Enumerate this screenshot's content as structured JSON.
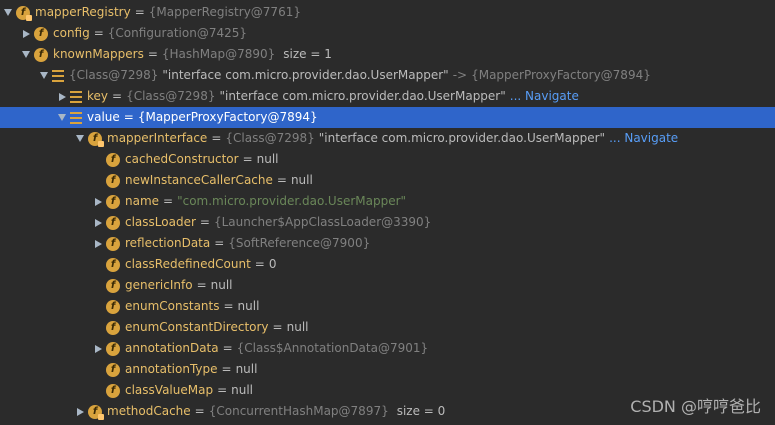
{
  "rows": [
    {
      "indent": 0,
      "arrow": "down",
      "icon": "field-static",
      "name": "mapperRegistry",
      "eq": "=",
      "ref": "{MapperRegistry@7761}"
    },
    {
      "indent": 1,
      "arrow": "right",
      "icon": "field",
      "name": "config",
      "eq": "=",
      "ref": "{Configuration@7425}"
    },
    {
      "indent": 1,
      "arrow": "down",
      "icon": "field",
      "name": "knownMappers",
      "eq": "=",
      "ref": "{HashMap@7890}",
      "extra": "size = 1"
    },
    {
      "indent": 2,
      "arrow": "down",
      "icon": "list",
      "ref": "{Class@7298}",
      "str": "\"interface com.micro.provider.dao.UserMapper\"",
      "arrowText": "->",
      "ref2": "{MapperProxyFactory@7894}"
    },
    {
      "indent": 3,
      "arrow": "right",
      "icon": "list",
      "name": "key",
      "eq": "=",
      "ref": "{Class@7298}",
      "str": "\"interface com.micro.provider.dao.UserMapper\"",
      "nav": "... Navigate"
    },
    {
      "indent": 3,
      "arrow": "down",
      "icon": "list",
      "name": "value",
      "eq": "=",
      "ref": "{MapperProxyFactory@7894}",
      "selected": true
    },
    {
      "indent": 4,
      "arrow": "down",
      "icon": "field-static",
      "name": "mapperInterface",
      "eq": "=",
      "ref": "{Class@7298}",
      "str": "\"interface com.micro.provider.dao.UserMapper\"",
      "nav": "... Navigate"
    },
    {
      "indent": 5,
      "arrow": "none",
      "icon": "field",
      "name": "cachedConstructor",
      "eq": "=",
      "val": "null"
    },
    {
      "indent": 5,
      "arrow": "none",
      "icon": "field",
      "name": "newInstanceCallerCache",
      "eq": "=",
      "val": "null"
    },
    {
      "indent": 5,
      "arrow": "right",
      "icon": "field",
      "name": "name",
      "eq": "=",
      "strg": "\"com.micro.provider.dao.UserMapper\""
    },
    {
      "indent": 5,
      "arrow": "right",
      "icon": "field",
      "name": "classLoader",
      "eq": "=",
      "ref": "{Launcher$AppClassLoader@3390}"
    },
    {
      "indent": 5,
      "arrow": "right",
      "icon": "field",
      "name": "reflectionData",
      "eq": "=",
      "ref": "{SoftReference@7900}"
    },
    {
      "indent": 5,
      "arrow": "none",
      "icon": "field",
      "name": "classRedefinedCount",
      "eq": "=",
      "val": "0"
    },
    {
      "indent": 5,
      "arrow": "none",
      "icon": "field",
      "name": "genericInfo",
      "eq": "=",
      "val": "null"
    },
    {
      "indent": 5,
      "arrow": "none",
      "icon": "field",
      "name": "enumConstants",
      "eq": "=",
      "val": "null"
    },
    {
      "indent": 5,
      "arrow": "none",
      "icon": "field",
      "name": "enumConstantDirectory",
      "eq": "=",
      "val": "null"
    },
    {
      "indent": 5,
      "arrow": "right",
      "icon": "field",
      "name": "annotationData",
      "eq": "=",
      "ref": "{Class$AnnotationData@7901}"
    },
    {
      "indent": 5,
      "arrow": "none",
      "icon": "field",
      "name": "annotationType",
      "eq": "=",
      "val": "null"
    },
    {
      "indent": 5,
      "arrow": "none",
      "icon": "field",
      "name": "classValueMap",
      "eq": "=",
      "val": "null"
    },
    {
      "indent": 4,
      "arrow": "right",
      "icon": "field-static",
      "name": "methodCache",
      "eq": "=",
      "ref": "{ConcurrentHashMap@7897}",
      "extra": "size = 0"
    }
  ],
  "watermark": "CSDN @哼哼爸比"
}
